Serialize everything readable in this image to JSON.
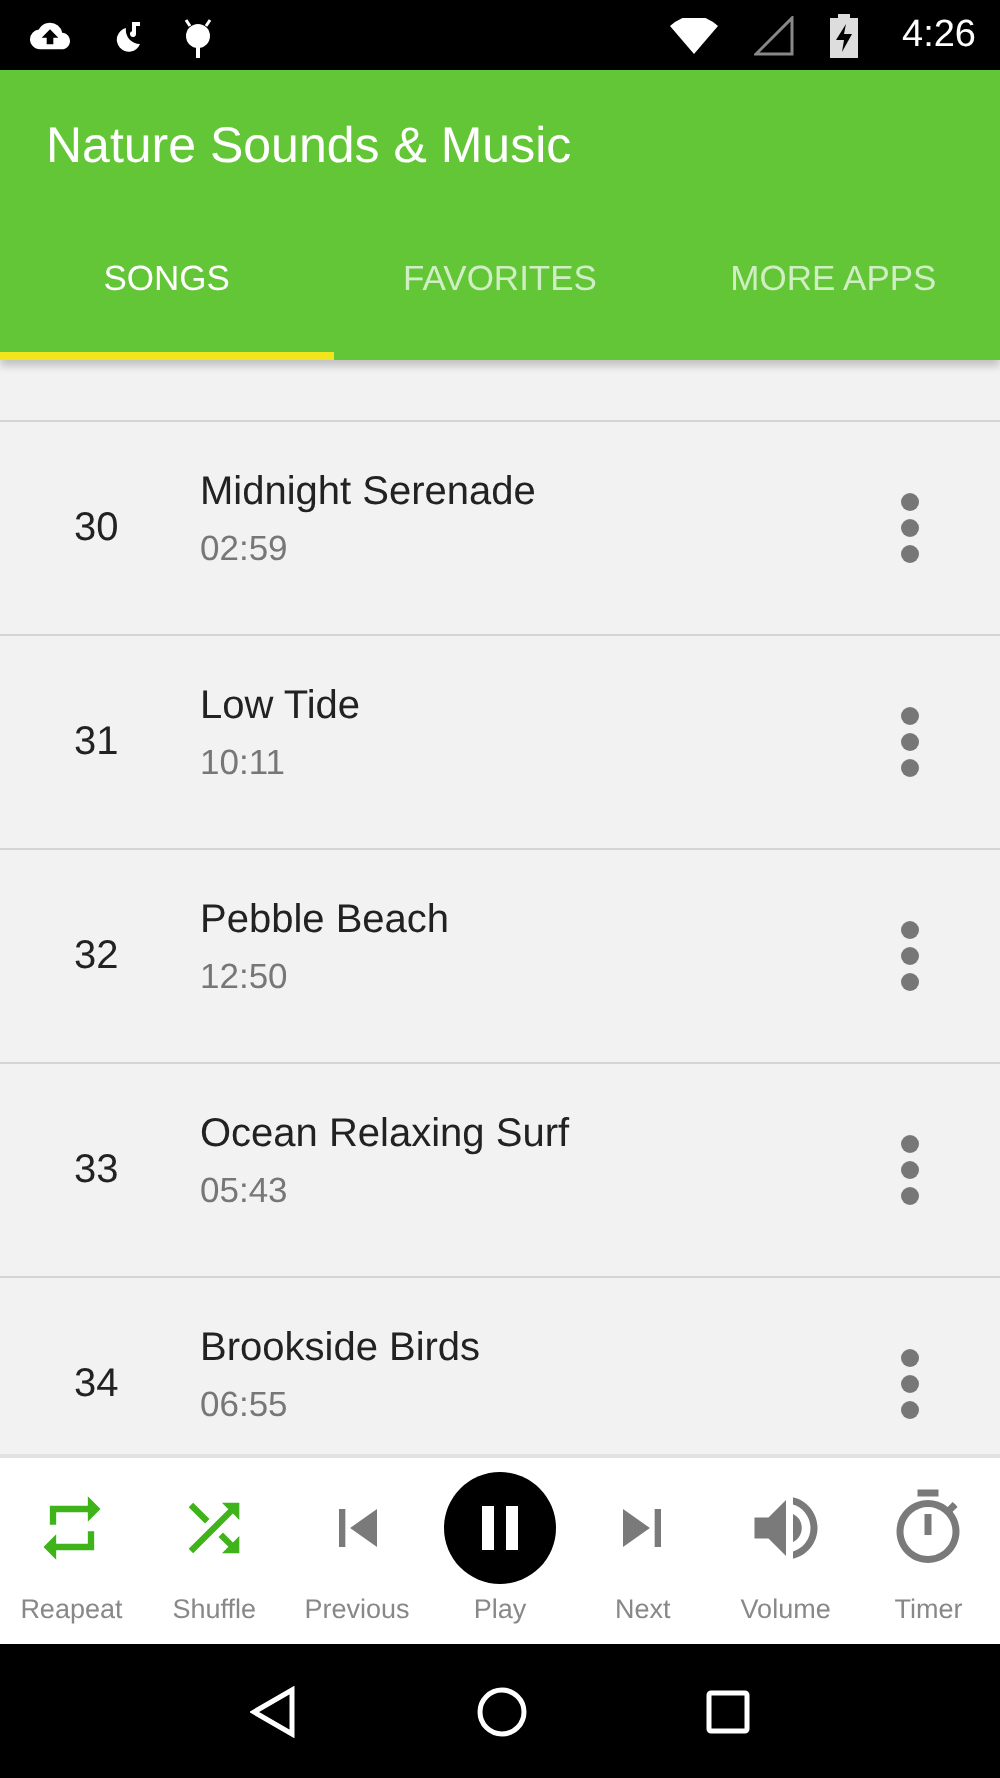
{
  "status_bar": {
    "time": "4:26"
  },
  "app_bar": {
    "title": "Nature Sounds & Music"
  },
  "tabs": [
    {
      "label": "SONGS",
      "selected": true
    },
    {
      "label": "FAVORITES",
      "selected": false
    },
    {
      "label": "MORE APPS",
      "selected": false
    }
  ],
  "songs": [
    {
      "number": "30",
      "title": "Midnight Serenade",
      "duration": "02:59"
    },
    {
      "number": "31",
      "title": "Low Tide",
      "duration": "10:11"
    },
    {
      "number": "32",
      "title": "Pebble Beach",
      "duration": "12:50"
    },
    {
      "number": "33",
      "title": "Ocean Relaxing Surf",
      "duration": "05:43"
    },
    {
      "number": "34",
      "title": "Brookside Birds",
      "duration": "06:55"
    }
  ],
  "player_controls": [
    {
      "kind": "repeat",
      "label": "Reapeat",
      "on": true
    },
    {
      "kind": "shuffle",
      "label": "Shuffle",
      "on": true
    },
    {
      "kind": "previous",
      "label": "Previous",
      "on": false
    },
    {
      "kind": "play",
      "label": "Play",
      "on": true
    },
    {
      "kind": "next",
      "label": "Next",
      "on": false
    },
    {
      "kind": "volume",
      "label": "Volume",
      "on": false
    },
    {
      "kind": "timer",
      "label": "Timer",
      "on": false
    }
  ]
}
